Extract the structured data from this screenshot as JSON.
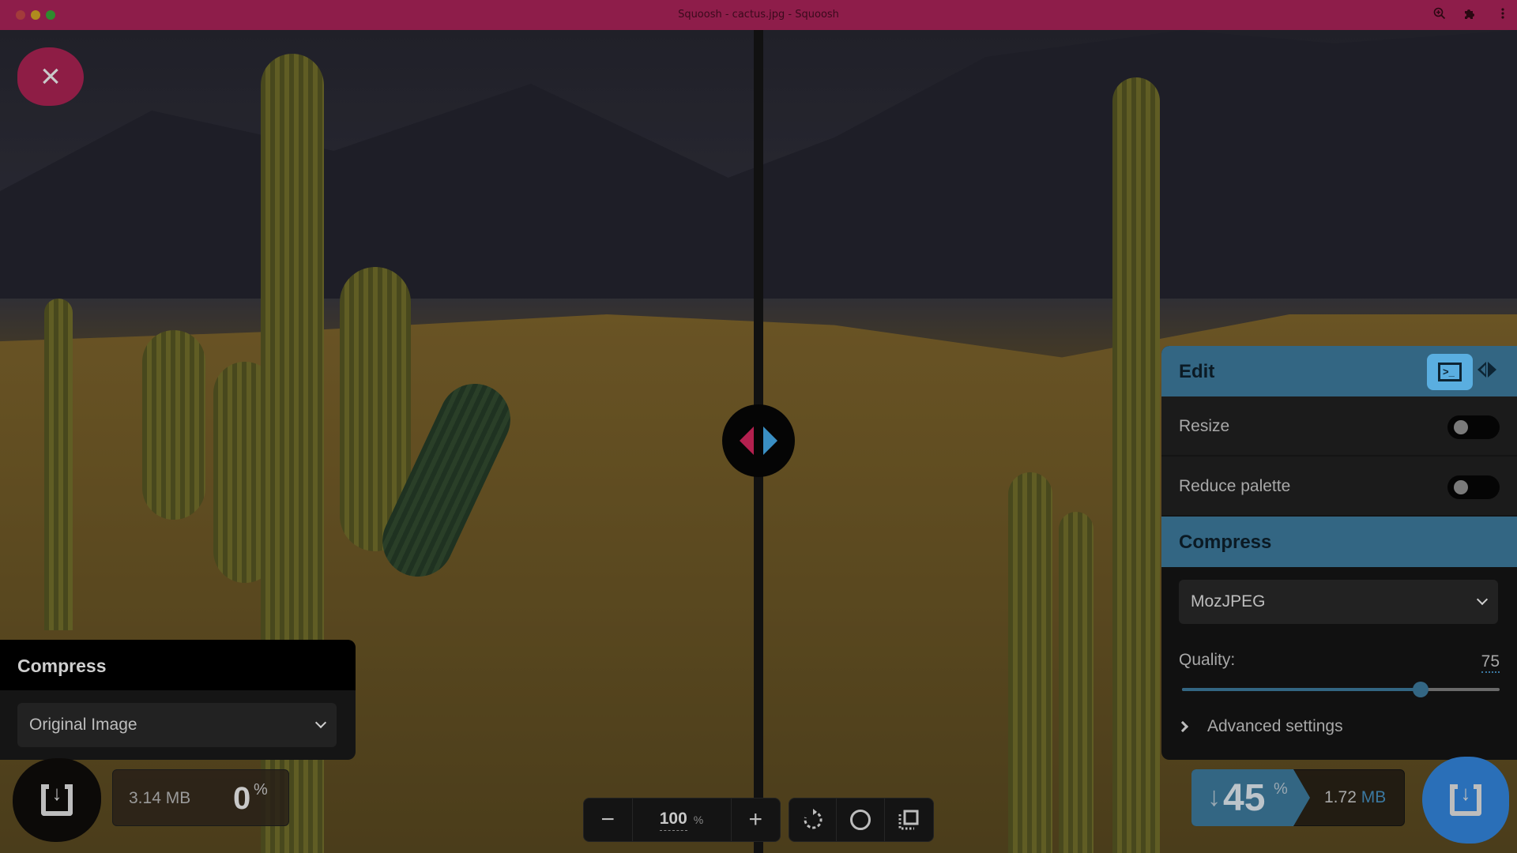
{
  "window": {
    "title": "Squoosh - cactus.jpg - Squoosh",
    "toolbar_icons": [
      "zoom-in-icon",
      "extensions-icon",
      "more-menu-icon"
    ]
  },
  "canvas": {
    "image_alt": "Saguaro cactus desert landscape",
    "close_icon": "×"
  },
  "left_panel": {
    "header": "Compress",
    "codec_selected": "Original Image",
    "file_size": "3.14 MB",
    "percent_change": "0",
    "percent_sign": "%"
  },
  "toolbar": {
    "zoom_out_icon": "−",
    "zoom_value": "100",
    "zoom_unit": "%",
    "zoom_in_icon": "+",
    "rotate_icon": "⟳",
    "background_toggle_icon": "○",
    "view_toggle_icon": "⧉"
  },
  "right_panel": {
    "edit_header": "Edit",
    "edit_options": [
      {
        "label": "Resize",
        "enabled": false
      },
      {
        "label": "Reduce palette",
        "enabled": false
      }
    ],
    "compress_header": "Compress",
    "codec_selected": "MozJPEG",
    "quality_label": "Quality:",
    "quality_value": 75,
    "quality_max": 100,
    "advanced_label": "Advanced settings",
    "result": {
      "arrow": "↓",
      "percent_saved": "45",
      "percent_sign": "%",
      "size_value": "1.72",
      "size_unit": "MB"
    }
  },
  "colors": {
    "accent_pink": "#8e1d4a",
    "accent_blue": "#336683",
    "download_blue": "#2a6fb8"
  }
}
